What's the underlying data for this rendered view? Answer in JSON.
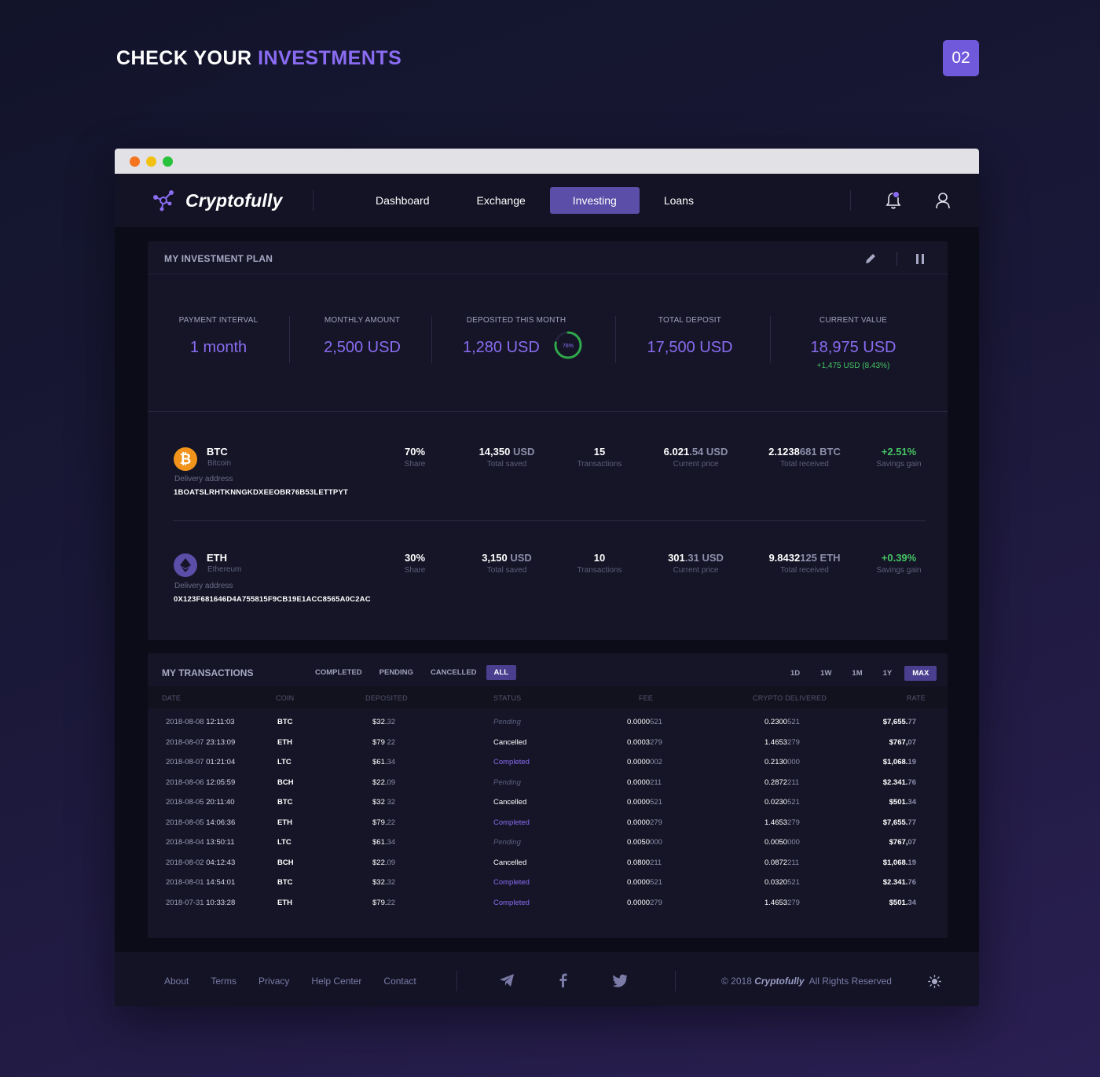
{
  "hero": {
    "title_plain": "CHECK YOUR ",
    "title_accent": "INVESTMENTS",
    "step": "02"
  },
  "app": {
    "brand": "Cryptofully",
    "nav": [
      {
        "label": "Dashboard",
        "active": false
      },
      {
        "label": "Exchange",
        "active": false
      },
      {
        "label": "Investing",
        "active": true
      },
      {
        "label": "Loans",
        "active": false
      }
    ],
    "icons": {
      "bell": "bell-icon",
      "user": "user-icon"
    }
  },
  "plan": {
    "title": "MY INVESTMENT PLAN",
    "stats": [
      {
        "label": "PAYMENT INTERVAL",
        "value": "1 month"
      },
      {
        "label": "MONTHLY AMOUNT",
        "value": "2,500 USD"
      },
      {
        "label": "DEPOSITED THIS MONTH",
        "value": "1,280 USD",
        "progress_label": "78%",
        "progress": 0.78
      },
      {
        "label": "TOTAL DEPOSIT",
        "value": "17,500 USD"
      },
      {
        "label": "CURRENT VALUE",
        "value": "18,975 USD",
        "sub": "+1,475 USD (8.43%)"
      }
    ],
    "coins": [
      {
        "symbol": "BTC",
        "name": "Bitcoin",
        "icon_glyph": "₿",
        "address_label": "Delivery address",
        "address": "1BOATSLRHTKNNGKDXEEOBR76B53LETTPYT",
        "share": "70%",
        "share_label": "Share",
        "saved_main": "14,350",
        "saved_unit": " USD",
        "saved_label": "Total saved",
        "transactions": "15",
        "transactions_label": "Transactions",
        "price_main": "6.021",
        "price_dim": ".54 USD",
        "price_label": "Current price",
        "received_main": "2.1238",
        "received_dim": "681 BTC",
        "received_label": "Total received",
        "gain": "+2.51%",
        "gain_label": "Savings gain"
      },
      {
        "symbol": "ETH",
        "name": "Ethereum",
        "icon_glyph": "",
        "address_label": "Delivery address",
        "address": "0X123F681646D4A755815F9CB19E1ACC8565A0C2AC",
        "share": "30%",
        "share_label": "Share",
        "saved_main": "3,150",
        "saved_unit": " USD",
        "saved_label": "Total saved",
        "transactions": "10",
        "transactions_label": "Transactions",
        "price_main": "301",
        "price_dim": ".31 USD",
        "price_label": "Current price",
        "received_main": "9.8432",
        "received_dim": "125 ETH",
        "received_label": "Total received",
        "gain": "+0.39%",
        "gain_label": "Savings gain"
      }
    ]
  },
  "transactions": {
    "title": "MY TRANSACTIONS",
    "filters": [
      "COMPLETED",
      "PENDING",
      "CANCELLED",
      "ALL"
    ],
    "active_filter": "ALL",
    "ranges": [
      "1D",
      "1W",
      "1M",
      "1Y",
      "MAX"
    ],
    "active_range": "MAX",
    "columns": [
      "DATE",
      "COIN",
      "DEPOSITED",
      "STATUS",
      "FEE",
      "CRYPTO DELIVERED",
      "RATE"
    ],
    "rows": [
      {
        "date": "2018-08-08",
        "time": "12:11:03",
        "coin": "BTC",
        "dep_main": "$32.",
        "dep_dim": "32",
        "status": "Pending",
        "fee_main": "0.0000",
        "fee_dim": "521",
        "crypto_main": "0.2300",
        "crypto_dim": "521",
        "rate_main": "$7,655.",
        "rate_dim": "77"
      },
      {
        "date": "2018-08-07",
        "time": "23:13:09",
        "coin": "ETH",
        "dep_main": "$79 ",
        "dep_dim": "22",
        "status": "Cancelled",
        "fee_main": "0.0003",
        "fee_dim": "279",
        "crypto_main": "1.4653",
        "crypto_dim": "279",
        "rate_main": "$767,",
        "rate_dim": "07"
      },
      {
        "date": "2018-08-07",
        "time": "01:21:04",
        "coin": "LTC",
        "dep_main": "$61.",
        "dep_dim": "34",
        "status": "Completed",
        "fee_main": "0.0000",
        "fee_dim": "002",
        "crypto_main": "0.2130",
        "crypto_dim": "000",
        "rate_main": "$1,068.",
        "rate_dim": "19"
      },
      {
        "date": "2018-08-06",
        "time": "12:05:59",
        "coin": "BCH",
        "dep_main": "$22.",
        "dep_dim": "09",
        "status": "Pending",
        "fee_main": "0.0000",
        "fee_dim": "211",
        "crypto_main": "0.2872",
        "crypto_dim": "211",
        "rate_main": "$2.341.",
        "rate_dim": "76"
      },
      {
        "date": "2018-08-05",
        "time": "20:11:40",
        "coin": "BTC",
        "dep_main": "$32 ",
        "dep_dim": "32",
        "status": "Cancelled",
        "fee_main": "0.0000",
        "fee_dim": "521",
        "crypto_main": "0.0230",
        "crypto_dim": "521",
        "rate_main": "$501.",
        "rate_dim": "34"
      },
      {
        "date": "2018-08-05",
        "time": "14:06:36",
        "coin": "ETH",
        "dep_main": "$79.",
        "dep_dim": "22",
        "status": "Completed",
        "fee_main": "0.0000",
        "fee_dim": "279",
        "crypto_main": "1.4653",
        "crypto_dim": "279",
        "rate_main": "$7,655.",
        "rate_dim": "77"
      },
      {
        "date": "2018-08-04",
        "time": "13:50:11",
        "coin": "LTC",
        "dep_main": "$61.",
        "dep_dim": "34",
        "status": "Pending",
        "fee_main": "0.0050",
        "fee_dim": "000",
        "crypto_main": "0.0050",
        "crypto_dim": "000",
        "rate_main": "$767,",
        "rate_dim": "07"
      },
      {
        "date": "2018-08-02",
        "time": "04:12:43",
        "coin": "BCH",
        "dep_main": "$22.",
        "dep_dim": "09",
        "status": "Cancelled",
        "fee_main": "0.0800",
        "fee_dim": "211",
        "crypto_main": "0.0872",
        "crypto_dim": "211",
        "rate_main": "$1,068.",
        "rate_dim": "19"
      },
      {
        "date": "2018-08-01",
        "time": "14:54:01",
        "coin": "BTC",
        "dep_main": "$32.",
        "dep_dim": "32",
        "status": "Completed",
        "fee_main": "0.0000",
        "fee_dim": "521",
        "crypto_main": "0.0320",
        "crypto_dim": "521",
        "rate_main": "$2.341.",
        "rate_dim": "76"
      },
      {
        "date": "2018-07-31",
        "time": "10:33:28",
        "coin": "ETH",
        "dep_main": "$79.",
        "dep_dim": "22",
        "status": "Completed",
        "fee_main": "0.0000",
        "fee_dim": "279",
        "crypto_main": "1.4653",
        "crypto_dim": "279",
        "rate_main": "$501.",
        "rate_dim": "34"
      }
    ]
  },
  "footer": {
    "links": [
      "About",
      "Terms",
      "Privacy",
      "Help Center",
      "Contact"
    ],
    "social": [
      "telegram-icon",
      "facebook-icon",
      "twitter-icon"
    ],
    "copyright_prefix": "© 2018 ",
    "copyright_brand": "Cryptofully",
    "copyright_suffix": "  All Rights Reserved"
  },
  "colors": {
    "accent": "#8a6cf2",
    "active_nav": "#5b4ea8",
    "gain": "#45c463",
    "btc": "#f2941c",
    "eth": "#5b4ea8"
  }
}
